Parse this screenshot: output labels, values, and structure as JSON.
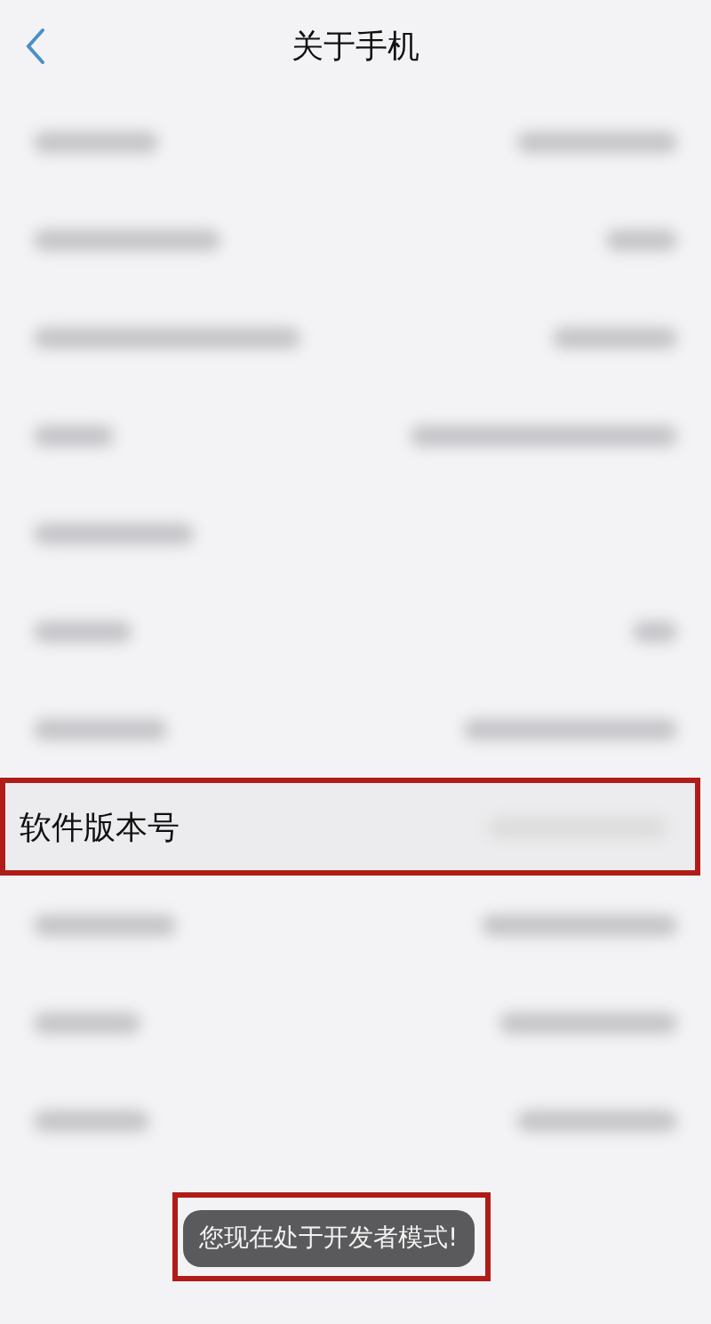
{
  "header": {
    "title": "关于手机"
  },
  "rows": [
    {
      "kind": "blurred",
      "highlighted": false
    },
    {
      "kind": "blurred",
      "highlighted": false
    },
    {
      "kind": "blurred",
      "highlighted": false
    },
    {
      "kind": "blurred",
      "highlighted": false
    },
    {
      "kind": "blurred",
      "highlighted": false
    },
    {
      "kind": "blurred",
      "highlighted": false
    },
    {
      "kind": "blurred",
      "highlighted": false
    },
    {
      "kind": "text",
      "label": "软件版本号",
      "highlighted": true
    },
    {
      "kind": "blurred",
      "highlighted": false
    },
    {
      "kind": "blurred",
      "highlighted": false
    },
    {
      "kind": "blurred",
      "highlighted": false
    }
  ],
  "toast": {
    "text": "您现在处于开发者模式!",
    "highlighted": true
  }
}
